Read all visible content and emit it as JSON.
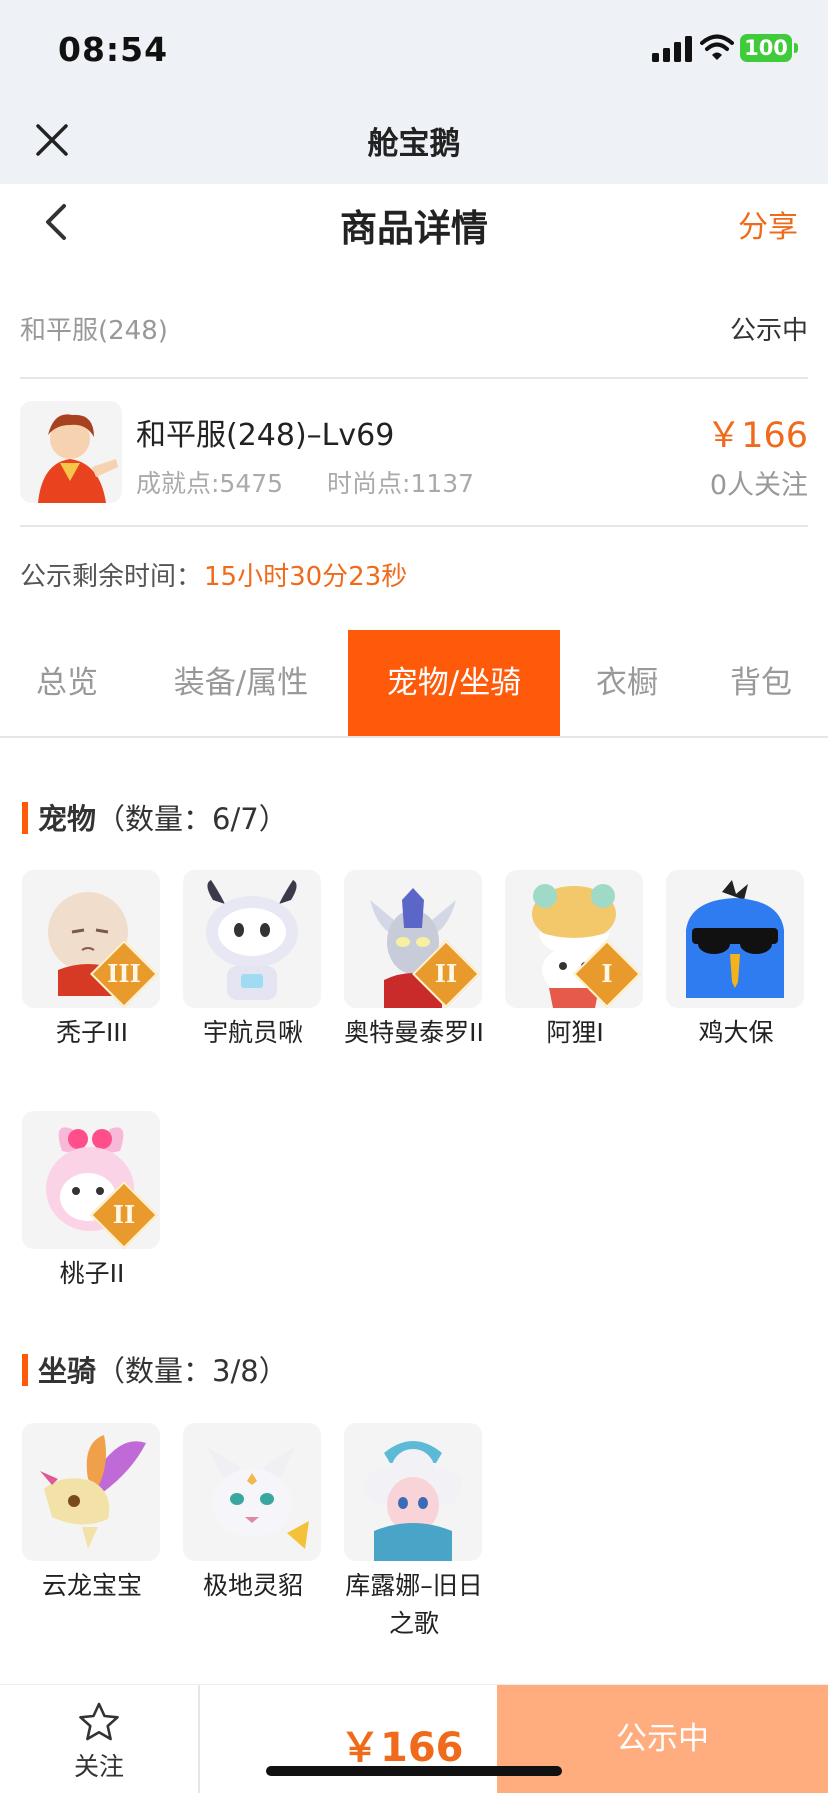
{
  "status_bar": {
    "time": "08:54",
    "battery": "100"
  },
  "app_header": {
    "title": "舱宝鹅"
  },
  "page_header": {
    "title": "商品详情",
    "share": "分享"
  },
  "listing": {
    "server": "和平服(248)",
    "status": "公示中",
    "name": "和平服(248)–Lv69",
    "achievement": "成就点:5475",
    "fashion": "时尚点:1137",
    "price": "￥166",
    "followers": "0人关注",
    "remaining_label": "公示剩余时间：",
    "remaining_value": "15小时30分23秒"
  },
  "tabs": [
    {
      "label": "总览",
      "active": false
    },
    {
      "label": "装备/属性",
      "active": false
    },
    {
      "label": "宠物/坐骑",
      "active": true
    },
    {
      "label": "衣橱",
      "active": false
    },
    {
      "label": "背包",
      "active": false
    }
  ],
  "pets": {
    "title": "宠物",
    "count": "（数量：6/7）",
    "items": [
      {
        "name": "秃子III",
        "badge": "III"
      },
      {
        "name": "宇航员啾",
        "badge": ""
      },
      {
        "name": "奥特曼泰罗II",
        "badge": "II"
      },
      {
        "name": "阿狸I",
        "badge": "I"
      },
      {
        "name": "鸡大保",
        "badge": ""
      },
      {
        "name": "桃子II",
        "badge": "II"
      }
    ]
  },
  "mounts": {
    "title": "坐骑",
    "count": "（数量：3/8）",
    "items": [
      {
        "name": "云龙宝宝"
      },
      {
        "name": "极地灵貂"
      },
      {
        "name": "库露娜–旧日之歌"
      }
    ]
  },
  "bottom_bar": {
    "follow": "关注",
    "price": "￥166",
    "cta": "公示中"
  },
  "colors": {
    "accent": "#ff5a0a",
    "price": "#f06a1b",
    "cta": "#ffac7f",
    "header_bg": "#eef2f7"
  }
}
